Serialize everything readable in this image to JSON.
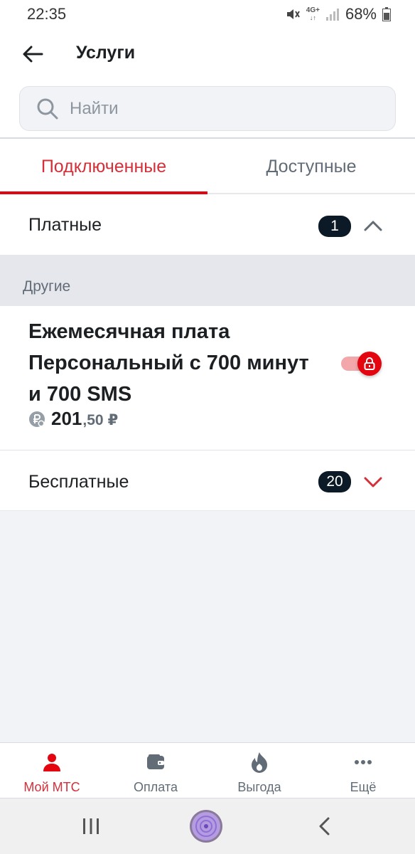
{
  "status_bar": {
    "time": "22:35",
    "network": "4G+",
    "battery": "68%"
  },
  "header": {
    "title": "Услуги"
  },
  "search": {
    "placeholder": "Найти",
    "value": ""
  },
  "tabs": [
    {
      "label": "Подключенные",
      "active": true
    },
    {
      "label": "Доступные",
      "active": false
    }
  ],
  "paid": {
    "label": "Платные",
    "count": "1",
    "expanded": true
  },
  "section": {
    "label": "Другие"
  },
  "service": {
    "title": "Ежемесячная плата Персональный с 700 минут и 700 SMS",
    "price_main": "201",
    "price_frac": ",50",
    "currency": "₽",
    "enabled": true,
    "locked": true
  },
  "free": {
    "label": "Бесплатные",
    "count": "20",
    "expanded": false
  },
  "bottom_nav": [
    {
      "label": "Мой МТС",
      "icon": "user-icon",
      "active": true
    },
    {
      "label": "Оплата",
      "icon": "wallet-icon",
      "active": false
    },
    {
      "label": "Выгода",
      "icon": "fire-icon",
      "active": false
    },
    {
      "label": "Ещё",
      "icon": "more-icon",
      "active": false
    }
  ],
  "colors": {
    "accent": "#e30611",
    "accent_text": "#d3303a",
    "badge": "#0b1a26",
    "background": "#f2f3f7"
  }
}
